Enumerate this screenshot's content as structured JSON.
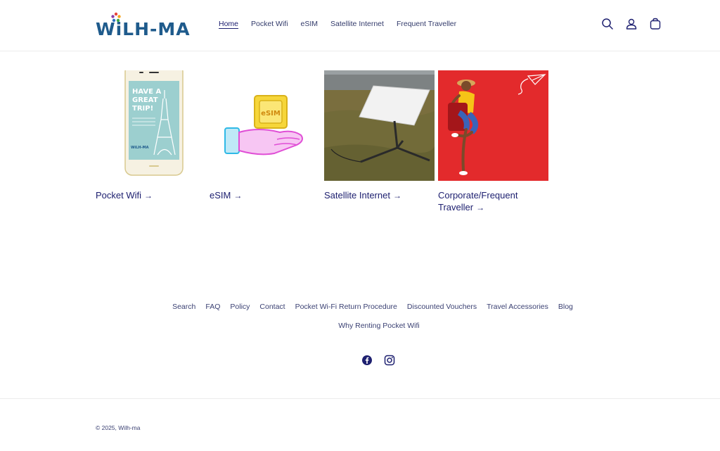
{
  "header": {
    "logo_text": "WiLH-MA",
    "nav": [
      {
        "label": "Home"
      },
      {
        "label": "Pocket Wifi"
      },
      {
        "label": "eSIM"
      },
      {
        "label": "Satellite Internet"
      },
      {
        "label": "Frequent Traveller"
      }
    ],
    "icons": [
      "search-icon",
      "account-icon",
      "cart-icon"
    ]
  },
  "collections": [
    {
      "title": "Pocket Wifi",
      "image_text_line1": "HAVE A",
      "image_text_line2": "GREAT",
      "image_text_line3": "TRIP!",
      "image_brand": "WiLH-MA"
    },
    {
      "title": "eSIM",
      "image_chip_label": "eSIM"
    },
    {
      "title": "Satellite Internet"
    },
    {
      "title_line1": "Corporate/Frequent",
      "title_line2": "Traveller"
    }
  ],
  "arrow": "→",
  "footer": {
    "links_row1": [
      "Search",
      "FAQ",
      "Policy",
      "Contact",
      "Pocket Wi-Fi Return Procedure",
      "Discounted Vouchers",
      "Travel Accessories",
      "Blog"
    ],
    "links_row2": [
      "Why Renting Pocket Wifi"
    ],
    "social": [
      "facebook-icon",
      "instagram-icon"
    ],
    "copyright_prefix": "© 2025,",
    "copyright_owner": "Wilh-ma"
  },
  "colors": {
    "brand_navy": "#1e2070",
    "logo_teal": "#1f5b8c",
    "red_bg": "#e32a2c"
  }
}
